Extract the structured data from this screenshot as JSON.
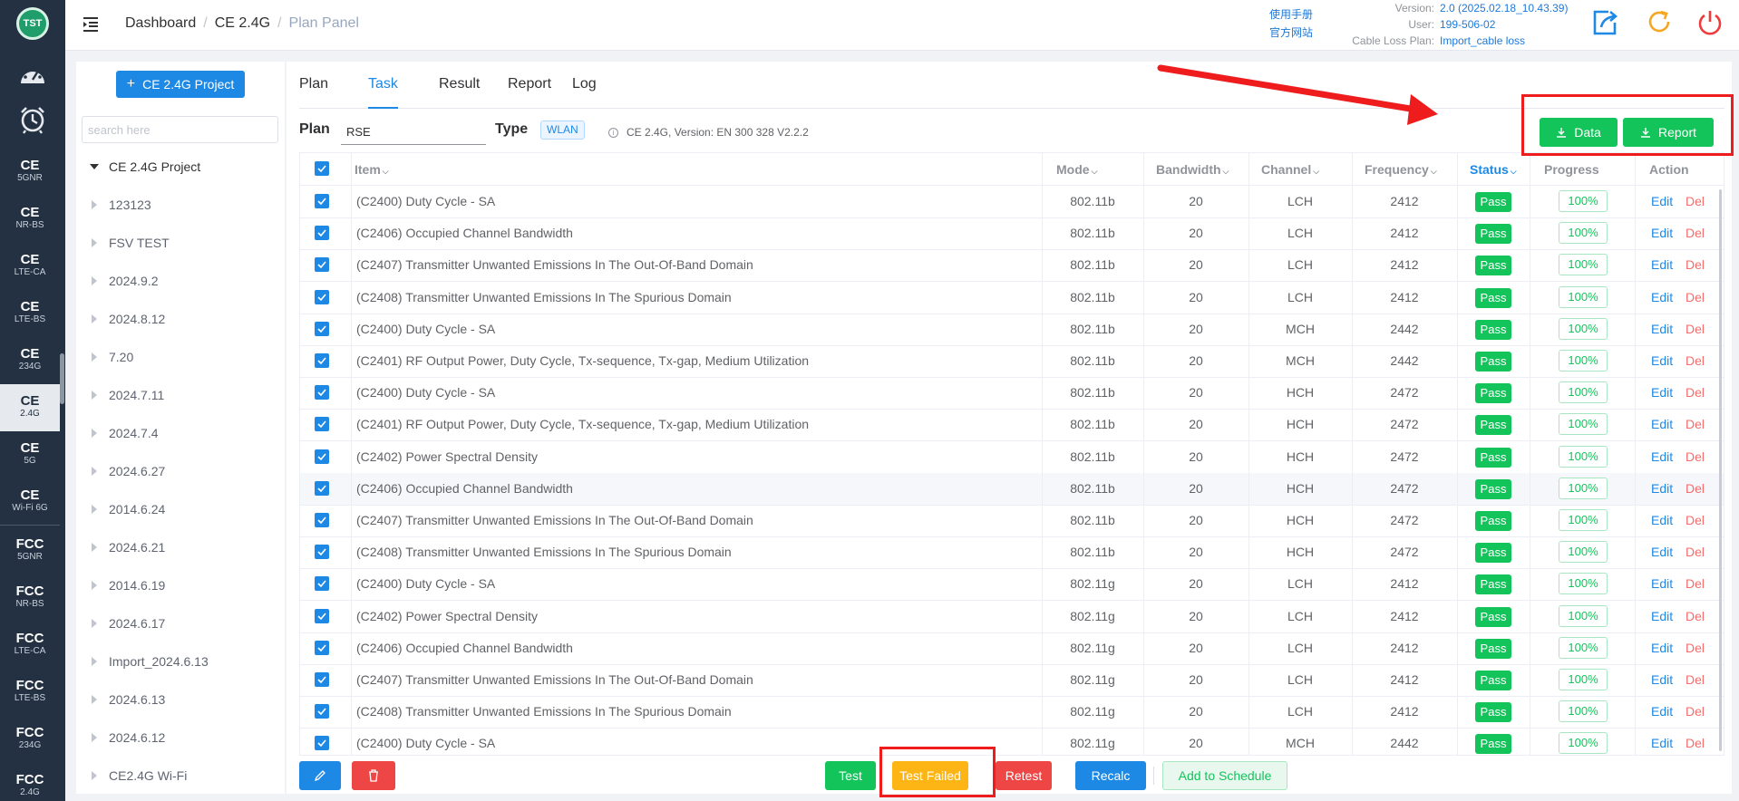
{
  "rail": {
    "logo": "TST",
    "items": [
      {
        "big": "CE",
        "small": "5GNR"
      },
      {
        "big": "CE",
        "small": "NR-BS"
      },
      {
        "big": "CE",
        "small": "LTE-CA"
      },
      {
        "big": "CE",
        "small": "LTE-BS"
      },
      {
        "big": "CE",
        "small": "234G"
      },
      {
        "big": "CE",
        "small": "2.4G"
      },
      {
        "big": "CE",
        "small": "5G"
      },
      {
        "big": "CE",
        "small": "Wi-Fi 6G"
      },
      {
        "big": "FCC",
        "small": "5GNR"
      },
      {
        "big": "FCC",
        "small": "NR-BS"
      },
      {
        "big": "FCC",
        "small": "LTE-CA"
      },
      {
        "big": "FCC",
        "small": "LTE-BS"
      },
      {
        "big": "FCC",
        "small": "234G"
      },
      {
        "big": "FCC",
        "small": "2.4G"
      }
    ]
  },
  "header": {
    "breadcrumb": [
      "Dashboard",
      "CE 2.4G",
      "Plan Panel"
    ],
    "links": [
      "使用手册",
      "官方网站"
    ],
    "info": [
      {
        "k": "Version:",
        "v": "2.0 (2025.02.18_10.43.39)"
      },
      {
        "k": "User:",
        "v": "199-506-02"
      },
      {
        "k": "Cable Loss Plan:",
        "v": "Import_cable loss"
      }
    ],
    "icons": [
      "export-icon",
      "refresh-icon",
      "power-icon"
    ],
    "colors": {
      "export": "#1e88e5",
      "refresh": "#f5a623",
      "power": "#ee3b3b"
    }
  },
  "tree": {
    "project_button": "CE 2.4G Project",
    "search_placeholder": "search here",
    "root": "CE 2.4G Project",
    "nodes": [
      "123123",
      "FSV TEST",
      "2024.9.2",
      "2024.8.12",
      "7.20",
      "2024.7.11",
      "2024.7.4",
      "2024.6.27",
      "2014.6.24",
      "2024.6.21",
      "2014.6.19",
      "2024.6.17",
      "Import_2024.6.13",
      "2024.6.13",
      "2024.6.12",
      "CE2.4G Wi-Fi"
    ]
  },
  "tabs": [
    "Plan",
    "Task",
    "Result",
    "Report",
    "Log"
  ],
  "active_tab": "Task",
  "plan_bar": {
    "plan_label": "Plan",
    "plan_value": "RSE",
    "type_label": "Type",
    "type_tag": "WLAN",
    "info": "CE 2.4G, Version: EN 300 328 V2.2.2"
  },
  "download_buttons": {
    "data": "Data",
    "report": "Report"
  },
  "table": {
    "headers": [
      "Item",
      "Mode",
      "Bandwidth",
      "Channel",
      "Frequency",
      "Status",
      "Progress",
      "Action"
    ],
    "edit_label": "Edit",
    "del_label": "Del",
    "rows": [
      {
        "item": "(C2400) Duty Cycle - SA",
        "mode": "802.11b",
        "bw": "20",
        "ch": "LCH",
        "freq": "2412",
        "status": "Pass",
        "progress": "100%"
      },
      {
        "item": "(C2406) Occupied Channel Bandwidth",
        "mode": "802.11b",
        "bw": "20",
        "ch": "LCH",
        "freq": "2412",
        "status": "Pass",
        "progress": "100%"
      },
      {
        "item": "(C2407) Transmitter Unwanted Emissions In The Out-Of-Band Domain",
        "mode": "802.11b",
        "bw": "20",
        "ch": "LCH",
        "freq": "2412",
        "status": "Pass",
        "progress": "100%"
      },
      {
        "item": "(C2408) Transmitter Unwanted Emissions In The Spurious Domain",
        "mode": "802.11b",
        "bw": "20",
        "ch": "LCH",
        "freq": "2412",
        "status": "Pass",
        "progress": "100%"
      },
      {
        "item": "(C2400) Duty Cycle - SA",
        "mode": "802.11b",
        "bw": "20",
        "ch": "MCH",
        "freq": "2442",
        "status": "Pass",
        "progress": "100%"
      },
      {
        "item": "(C2401) RF Output Power, Duty Cycle, Tx-sequence, Tx-gap, Medium Utilization",
        "mode": "802.11b",
        "bw": "20",
        "ch": "MCH",
        "freq": "2442",
        "status": "Pass",
        "progress": "100%"
      },
      {
        "item": "(C2400) Duty Cycle - SA",
        "mode": "802.11b",
        "bw": "20",
        "ch": "HCH",
        "freq": "2472",
        "status": "Pass",
        "progress": "100%"
      },
      {
        "item": "(C2401) RF Output Power, Duty Cycle, Tx-sequence, Tx-gap, Medium Utilization",
        "mode": "802.11b",
        "bw": "20",
        "ch": "HCH",
        "freq": "2472",
        "status": "Pass",
        "progress": "100%"
      },
      {
        "item": "(C2402) Power Spectral Density",
        "mode": "802.11b",
        "bw": "20",
        "ch": "HCH",
        "freq": "2472",
        "status": "Pass",
        "progress": "100%"
      },
      {
        "item": "(C2406) Occupied Channel Bandwidth",
        "mode": "802.11b",
        "bw": "20",
        "ch": "HCH",
        "freq": "2472",
        "status": "Pass",
        "progress": "100%"
      },
      {
        "item": "(C2407) Transmitter Unwanted Emissions In The Out-Of-Band Domain",
        "mode": "802.11b",
        "bw": "20",
        "ch": "HCH",
        "freq": "2472",
        "status": "Pass",
        "progress": "100%"
      },
      {
        "item": "(C2408) Transmitter Unwanted Emissions In The Spurious Domain",
        "mode": "802.11b",
        "bw": "20",
        "ch": "HCH",
        "freq": "2472",
        "status": "Pass",
        "progress": "100%"
      },
      {
        "item": "(C2400) Duty Cycle - SA",
        "mode": "802.11g",
        "bw": "20",
        "ch": "LCH",
        "freq": "2412",
        "status": "Pass",
        "progress": "100%"
      },
      {
        "item": "(C2402) Power Spectral Density",
        "mode": "802.11g",
        "bw": "20",
        "ch": "LCH",
        "freq": "2412",
        "status": "Pass",
        "progress": "100%"
      },
      {
        "item": "(C2406) Occupied Channel Bandwidth",
        "mode": "802.11g",
        "bw": "20",
        "ch": "LCH",
        "freq": "2412",
        "status": "Pass",
        "progress": "100%"
      },
      {
        "item": "(C2407) Transmitter Unwanted Emissions In The Out-Of-Band Domain",
        "mode": "802.11g",
        "bw": "20",
        "ch": "LCH",
        "freq": "2412",
        "status": "Pass",
        "progress": "100%"
      },
      {
        "item": "(C2408) Transmitter Unwanted Emissions In The Spurious Domain",
        "mode": "802.11g",
        "bw": "20",
        "ch": "LCH",
        "freq": "2412",
        "status": "Pass",
        "progress": "100%"
      },
      {
        "item": "(C2400) Duty Cycle - SA",
        "mode": "802.11g",
        "bw": "20",
        "ch": "MCH",
        "freq": "2442",
        "status": "Pass",
        "progress": "100%"
      }
    ]
  },
  "footer": {
    "test": "Test",
    "test_failed": "Test Failed",
    "retest": "Retest",
    "recalc": "Recalc",
    "add_schedule": "Add to Schedule"
  },
  "colors": {
    "accent": "#1e88e5",
    "success": "#13c45b",
    "warning": "#fcb515",
    "danger": "#ee4545",
    "annotation": "#ee1c1c"
  }
}
